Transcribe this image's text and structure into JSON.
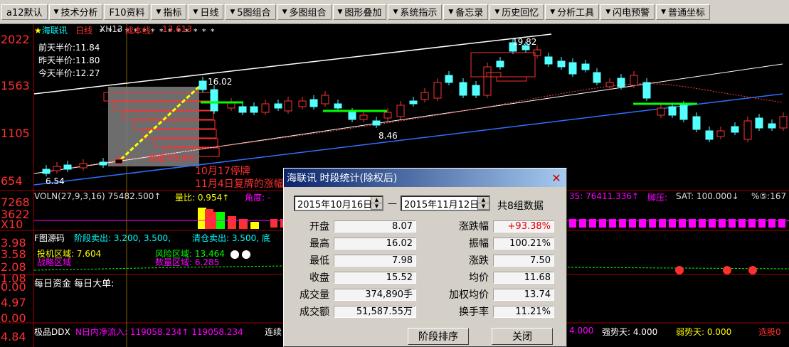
{
  "toolbar": {
    "items": [
      "a12默认",
      "技术分析",
      "F10资料",
      "指标",
      "日线",
      "5图组合",
      "多图组合",
      "图形叠加",
      "系统指示",
      "备忘录",
      "历史回忆",
      "分析工具",
      "闪电预警",
      "普通坐标"
    ]
  },
  "chart": {
    "stock_name": "海联讯",
    "period": "日线",
    "tag": "XH13",
    "cost_line_label": "成本线:",
    "cost_line_value": "13.613",
    "half_prices": [
      "前天半价:11.84",
      "昨天半价:11.80",
      "今天半价:12.27"
    ],
    "price_axis": [
      "2022",
      "1563",
      "1105",
      "654"
    ],
    "high_marks": [
      "19.82",
      "16.02"
    ],
    "low_marks": [
      "8.46",
      "6.54"
    ],
    "range_text": "涨幅 93.4%",
    "annot_1": "10月17停牌",
    "annot_2": "11月4日复牌的涨幅"
  },
  "volume_panel": {
    "left_labels": [
      "7268",
      "3622",
      "X10"
    ],
    "header": "VOLN(27,9,3,16)  75482.500↑",
    "lb": "量比: 0.954↑",
    "angle": "角度: -",
    "right": "35: 76411.336↑",
    "pressure": "脚压:",
    "sat": "SAT: 100.000↓",
    "pct": "%⑤:167"
  },
  "code_panel": {
    "left_labels": [
      "3.98",
      "3.58",
      "2.08",
      "1.08"
    ],
    "header": "F图源码",
    "sell": "阶段卖出: 3.200, 3.500,",
    "clear": "清仓卖出: 3.500, 底",
    "invest": "投机区域: 7.604",
    "risk": "风险区域: 13.464",
    "bottom": "战略区域",
    "sell_zone": "数量区域: 6.285"
  },
  "fund_panel": {
    "left_labels": [
      "0.00",
      "4.97",
      "0.00"
    ],
    "header": "每日资金 每日大单:"
  },
  "ddx_panel": {
    "left_labels": [
      "4.84"
    ],
    "header": "极品DDX",
    "flow": "N日内净流入: 119058.234↑ 119058.234",
    "link": "连续",
    "right": "4.000",
    "strong": "强势天: 4.000",
    "weak": "弱势天: 0.000",
    "pick": "选股0"
  },
  "dialog": {
    "title": "海联讯 时段统计(除权后)",
    "date_from": "2015年10月16日",
    "date_to": "2015年11月12日",
    "count": "共8组数据",
    "rows": [
      {
        "l": "开盘",
        "v": "8.07",
        "l2": "涨跌幅",
        "v2": "+93.38%"
      },
      {
        "l": "最高",
        "v": "16.02",
        "l2": "振幅",
        "v2": "100.21%"
      },
      {
        "l": "最低",
        "v": "7.98",
        "l2": "涨跌",
        "v2": "7.50"
      },
      {
        "l": "收盘",
        "v": "15.52",
        "l2": "均价",
        "v2": "11.68"
      },
      {
        "l": "成交量",
        "v": "374,890手",
        "l2": "加权均价",
        "v2": "13.74"
      },
      {
        "l": "成交额",
        "v": "51,587.55万",
        "l2": "换手率",
        "v2": "11.21%"
      }
    ],
    "btn_sort": "阶段排序",
    "btn_close": "关闭"
  },
  "colors": {
    "up": "#ff3232",
    "down": "#54ffff",
    "accent_yellow": "#ffff00",
    "avg_red": "#ff4040",
    "avg_blue": "#3070ff"
  }
}
